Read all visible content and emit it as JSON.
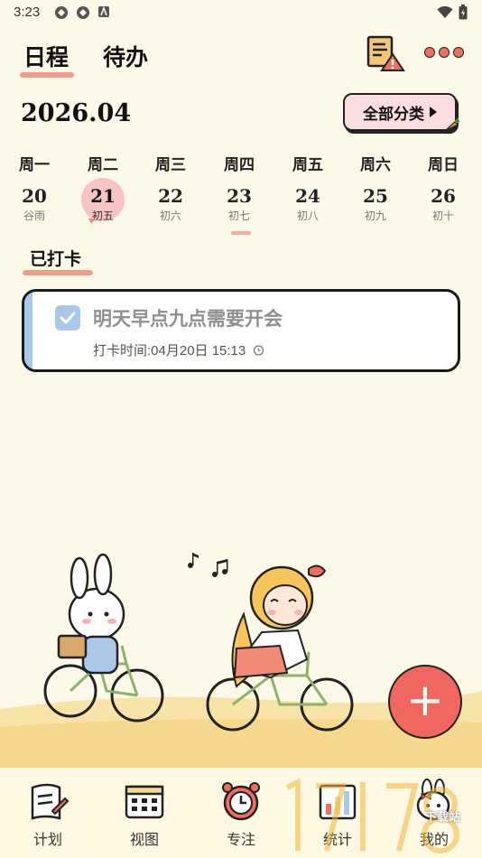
{
  "status_bar": {
    "time": "3:23"
  },
  "header": {
    "tabs": [
      {
        "label": "日程",
        "active": true
      },
      {
        "label": "待办",
        "active": false
      }
    ]
  },
  "month": "2026.04",
  "category_button": {
    "label": "全部分类"
  },
  "week": [
    {
      "weekday": "周一",
      "date": "20",
      "lunar": "谷雨",
      "selected": false
    },
    {
      "weekday": "周二",
      "date": "21",
      "lunar": "初五",
      "selected": true
    },
    {
      "weekday": "周三",
      "date": "22",
      "lunar": "初六",
      "selected": false
    },
    {
      "weekday": "周四",
      "date": "23",
      "lunar": "初七",
      "selected": false
    },
    {
      "weekday": "周五",
      "date": "24",
      "lunar": "初八",
      "selected": false
    },
    {
      "weekday": "周六",
      "date": "25",
      "lunar": "初九",
      "selected": false
    },
    {
      "weekday": "周日",
      "date": "26",
      "lunar": "初十",
      "selected": false
    }
  ],
  "section": {
    "title": "已打卡"
  },
  "tasks": [
    {
      "title": "明天早点九点需要开会",
      "checkin_time": "打卡时间:04月20日 15:13",
      "checked": true
    }
  ],
  "bottom_nav": [
    {
      "label": "计划",
      "icon": "plan-icon"
    },
    {
      "label": "视图",
      "icon": "calendar-view-icon"
    },
    {
      "label": "专注",
      "icon": "alarm-clock-icon"
    },
    {
      "label": "统计",
      "icon": "chart-icon"
    },
    {
      "label": "我的",
      "icon": "bunny-profile-icon"
    }
  ],
  "watermark": {
    "text": "下载站"
  },
  "colors": {
    "background": "#fdf9e8",
    "accent_pink": "#f08a7a",
    "fab": "#f0675f",
    "task_stripe": "#a9c8ea",
    "selected_day": "#f7c3c3"
  }
}
